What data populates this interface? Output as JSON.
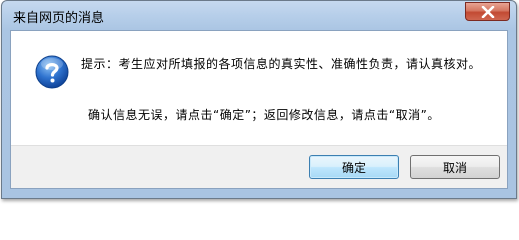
{
  "window": {
    "title": "来自网页的消息"
  },
  "icons": {
    "dialog": "question-icon",
    "close": "close-icon"
  },
  "message": {
    "line1": "提示：考生应对所填报的各项信息的真实性、准确性负责，请认真核对。",
    "line2": "确认信息无误，请点击“确定”；返回修改信息，请点击“取消”。"
  },
  "buttons": {
    "ok_label": "确定",
    "cancel_label": "取消"
  },
  "colors": {
    "titlebar": "#b7cfea",
    "close_button": "#c24a33",
    "default_button_border": "#3c7fb1"
  }
}
